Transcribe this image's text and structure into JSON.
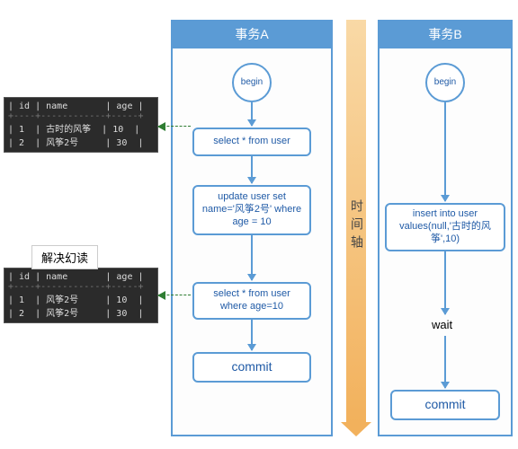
{
  "timeline_label": "时间轴",
  "laneA": {
    "title": "事务A",
    "begin": "begin",
    "step1": "select * from user",
    "step2": "update user set name='风筝2号' where age = 10",
    "step3": "select * from user where age=10",
    "commit": "commit"
  },
  "laneB": {
    "title": "事务B",
    "begin": "begin",
    "step1": "insert into user values(null,'古时的风筝',10)",
    "wait": "wait",
    "commit": "commit"
  },
  "table1": {
    "columns": [
      "id",
      "name",
      "age"
    ],
    "rows": [
      {
        "id": "1",
        "name": "古时的风筝",
        "age": "10"
      },
      {
        "id": "2",
        "name": "风筝2号",
        "age": "30"
      }
    ],
    "header_text": "| id | name       | age |",
    "sep_text": "+----+------------+-----+",
    "row1_text": "| 1  | 古时的风筝  | 10  |",
    "row2_text": "| 2  | 风筝2号     | 30  |"
  },
  "table2": {
    "title": "解决幻读",
    "columns": [
      "id",
      "name",
      "age"
    ],
    "rows": [
      {
        "id": "1",
        "name": "风筝2号",
        "age": "10"
      },
      {
        "id": "2",
        "name": "风筝2号",
        "age": "30"
      }
    ],
    "header_text": "| id | name       | age |",
    "sep_text": "+----+------------+-----+",
    "row1_text": "| 1  | 风筝2号     | 10  |",
    "row2_text": "| 2  | 风筝2号     | 30  |"
  },
  "chart_data": {
    "type": "flowchart",
    "title": "Transaction isolation example (解决幻读 / phantom-read prevention)",
    "lanes": [
      {
        "name": "事务A",
        "steps": [
          {
            "kind": "start",
            "label": "begin"
          },
          {
            "kind": "sql",
            "label": "select * from user",
            "result_ref": "table1"
          },
          {
            "kind": "sql",
            "label": "update user set name='风筝2号' where age = 10"
          },
          {
            "kind": "sql",
            "label": "select * from user where age=10",
            "result_ref": "table2"
          },
          {
            "kind": "end",
            "label": "commit"
          }
        ]
      },
      {
        "name": "事务B",
        "steps": [
          {
            "kind": "start",
            "label": "begin"
          },
          {
            "kind": "sql",
            "label": "insert into user values(null,'古时的风筝',10)"
          },
          {
            "kind": "note",
            "label": "wait"
          },
          {
            "kind": "end",
            "label": "commit"
          }
        ]
      }
    ],
    "axis": {
      "label": "时间轴",
      "direction": "down"
    }
  }
}
